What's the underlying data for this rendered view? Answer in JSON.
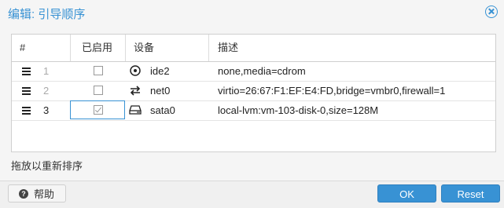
{
  "dialog": {
    "title": "编辑: 引导顺序"
  },
  "table": {
    "columns": [
      "#",
      "已启用",
      "设备",
      "描述"
    ],
    "rows": [
      {
        "order": "1",
        "enabled": false,
        "device": "ide2",
        "icon": "disc-icon",
        "description": "none,media=cdrom"
      },
      {
        "order": "2",
        "enabled": false,
        "device": "net0",
        "icon": "network-exchange-icon",
        "description": "virtio=26:67:F1:EF:E4:FD,bridge=vmbr0,firewall=1"
      },
      {
        "order": "3",
        "enabled": true,
        "device": "sata0",
        "icon": "hard-disk-icon",
        "description": "local-lvm:vm-103-disk-0,size=128M"
      }
    ]
  },
  "hint": "拖放以重新排序",
  "footer": {
    "help_label": "帮助",
    "ok_label": "OK",
    "reset_label": "Reset"
  },
  "colors": {
    "accent": "#3892d4"
  }
}
